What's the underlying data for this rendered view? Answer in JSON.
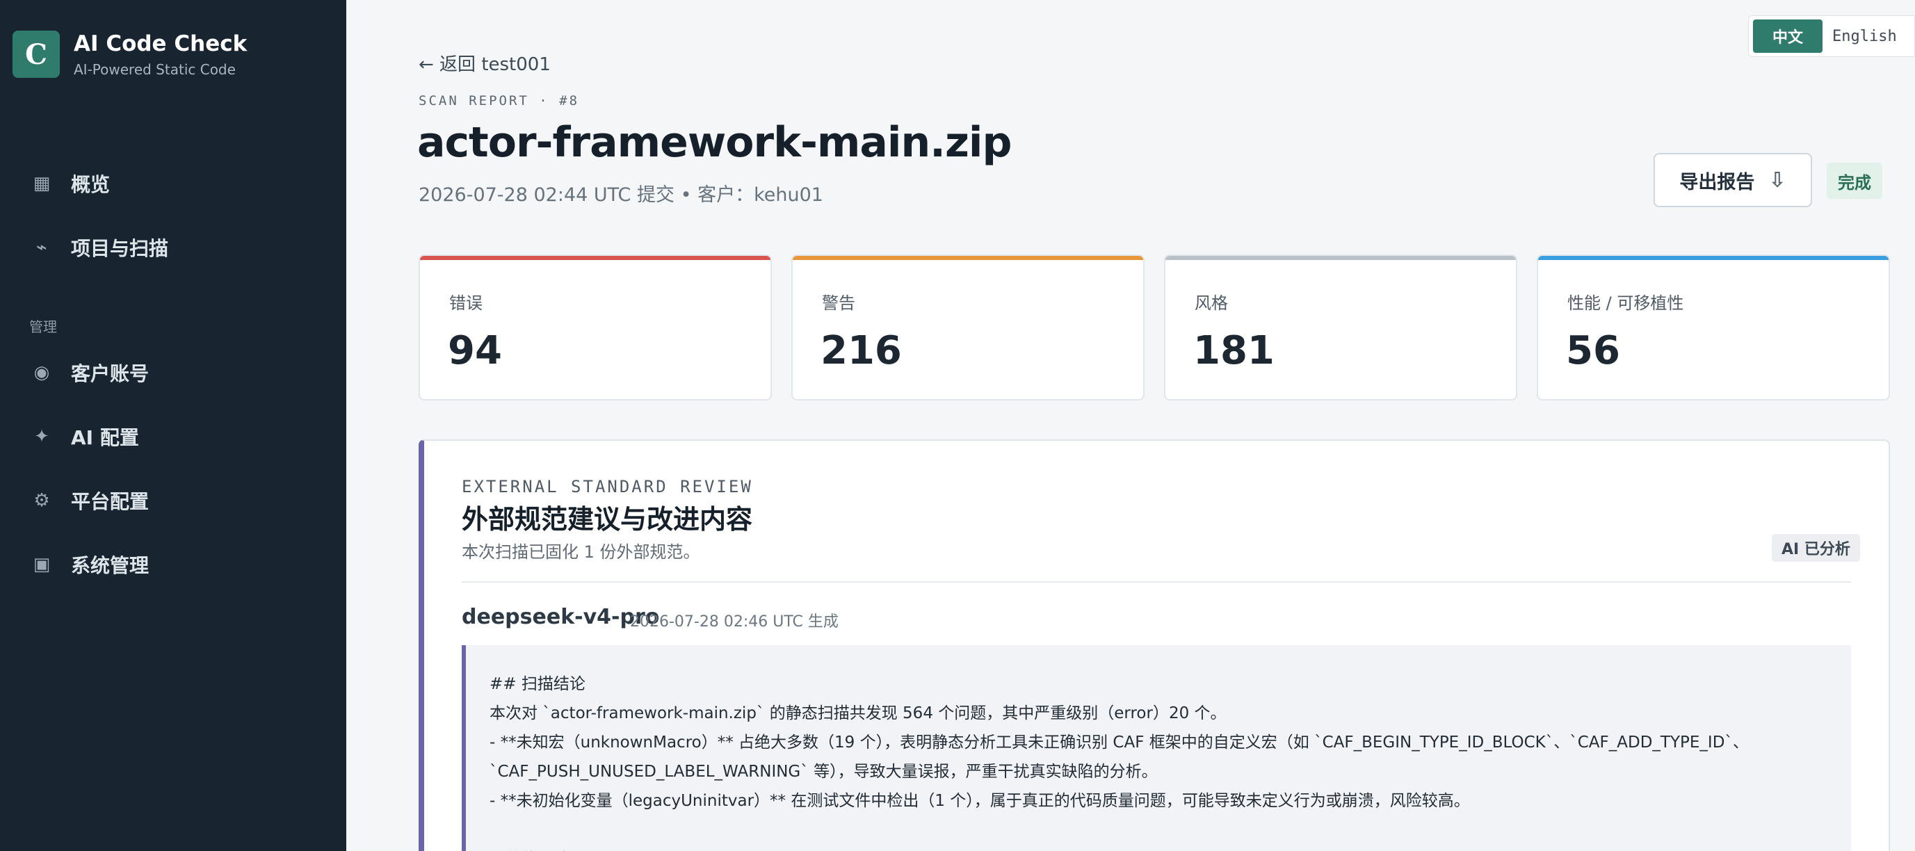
{
  "brand": {
    "logo_letter": "C",
    "title": "AI Code Check",
    "subtitle": "AI-Powered Static Code",
    "accent": "#2f7b6c"
  },
  "sidebar": {
    "items": [
      {
        "label": "概览",
        "icon": "grid-icon"
      },
      {
        "label": "项目与扫描",
        "icon": "activity-icon"
      }
    ],
    "group_label": "管理",
    "admin_items": [
      {
        "label": "客户账号",
        "icon": "user-circle-icon"
      },
      {
        "label": "AI 配置",
        "icon": "sparkle-icon"
      },
      {
        "label": "平台配置",
        "icon": "gear-icon"
      },
      {
        "label": "系统管理",
        "icon": "square-icon"
      }
    ]
  },
  "language": {
    "zh": "中文",
    "en": "English",
    "active": "zh"
  },
  "header": {
    "back_label": "← 返回 test001",
    "kicker": "SCAN REPORT · #8",
    "title": "actor-framework-main.zip",
    "meta": "2026-07-28 02:44 UTC 提交 • 客户：kehu01",
    "export_label": "导出报告",
    "status": "完成"
  },
  "stats": [
    {
      "label": "错误",
      "value": "94",
      "color": "#d9534f"
    },
    {
      "label": "警告",
      "value": "216",
      "color": "#e8963a"
    },
    {
      "label": "风格",
      "value": "181",
      "color": "#b9c2c9"
    },
    {
      "label": "性能 / 可移植性",
      "value": "56",
      "color": "#3b9ede"
    }
  ],
  "review": {
    "kicker": "EXTERNAL STANDARD REVIEW",
    "title": "外部规范建议与改进内容",
    "subtitle": "本次扫描已固化 1 份外部规范。",
    "ai_badge": "AI 已分析",
    "model": "deepseek-v4-pro",
    "generated": "2026-07-28 02:46 UTC 生成",
    "lines": [
      "## 扫描结论",
      "本次对 `actor-framework-main.zip` 的静态扫描共发现 564 个问题，其中严重级别（error）20 个。",
      "- **未知宏（unknownMacro）** 占绝大多数（19 个），表明静态分析工具未正确识别 CAF 框架中的自定义宏（如 `CAF_BEGIN_TYPE_ID_BLOCK`、`CAF_ADD_TYPE_ID`、",
      "`CAF_PUSH_UNUSED_LABEL_WARNING` 等），导致大量误报，严重干扰真实缺陷的分析。",
      "- **未初始化变量（legacyUninitvar）** 在测试文件中检出（1 个），属于真正的代码质量问题，可能导致未定义行为或崩溃，风险较高。",
      "",
      "**总体风险**"
    ]
  }
}
